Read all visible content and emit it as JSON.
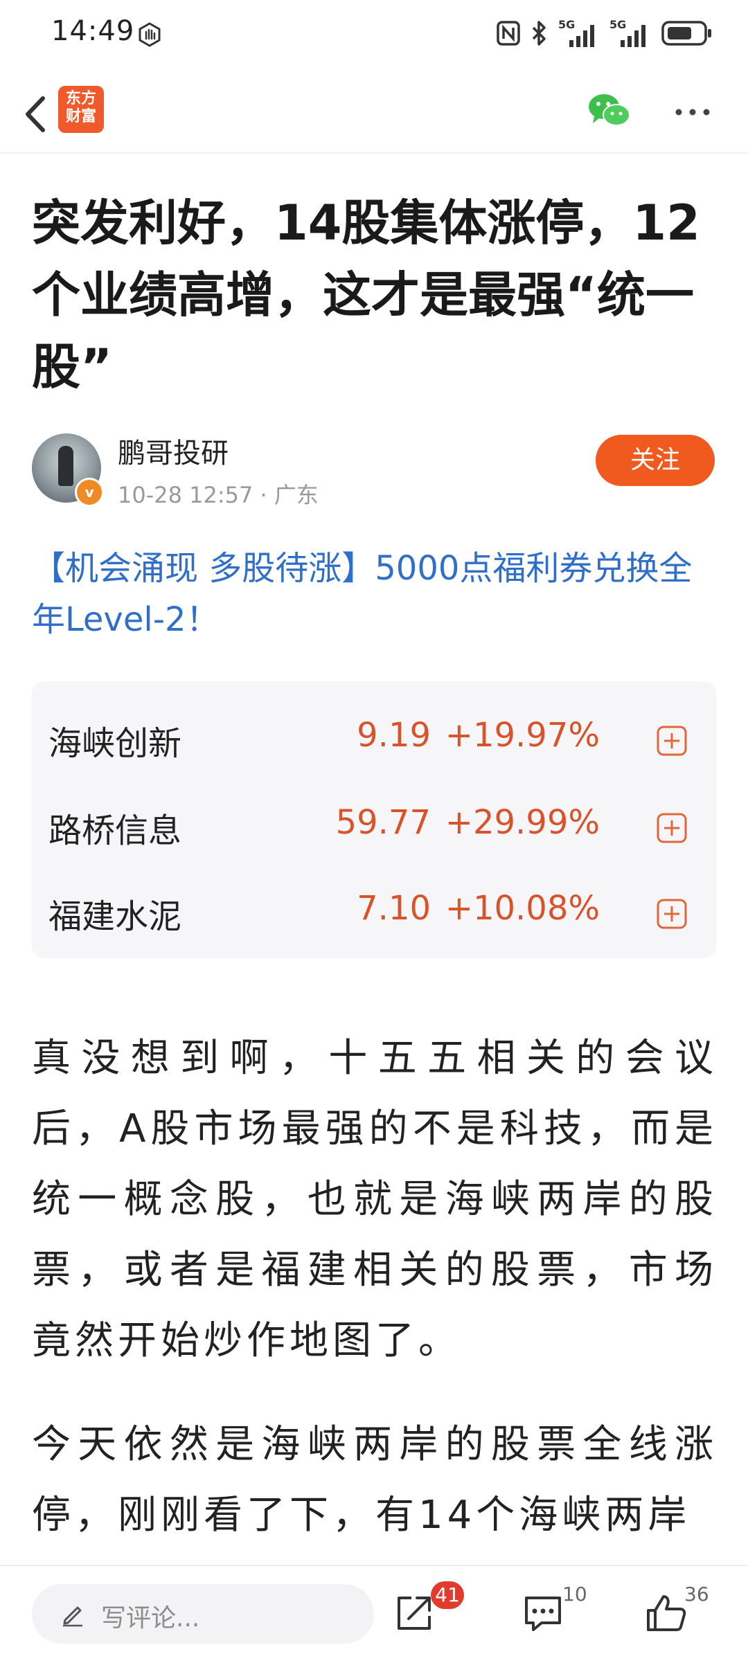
{
  "status_bar": {
    "time": "14:49",
    "network_1": "5G",
    "network_2": "5G",
    "icons": [
      "hand-icon",
      "nfc-icon",
      "bluetooth-icon",
      "signal-icon",
      "battery-icon"
    ]
  },
  "header": {
    "logo_text_line1": "东方",
    "logo_text_line2": "财富",
    "icons": [
      "back-arrow-icon",
      "wechat-icon",
      "more-icon"
    ]
  },
  "article": {
    "title": "突发利好，14股集体涨停，12个业绩高增，这才是最强“统一股”",
    "author": "鹏哥投研",
    "datetime": "10-28 12:57",
    "location": "广东",
    "verified_badge": "v",
    "follow_label": "关注",
    "promo_text": "【机会涌现 多股待涨】5000点福利券兑换全年Level-2！",
    "stocks": [
      {
        "name": "海峡创新",
        "price": "9.19",
        "change": "+19.97%"
      },
      {
        "name": "路桥信息",
        "price": "59.77",
        "change": "+29.99%"
      },
      {
        "name": "福建水泥",
        "price": "7.10",
        "change": "+10.08%"
      }
    ],
    "paragraphs": [
      "真没想到啊，十五五相关的会议后，A股市场最强的不是科技，而是统一概念股，也就是海峡两岸的股票，或者是福建相关的股票，市场竟然开始炒作地图了。",
      "今天依然是海峡两岸的股票全线涨停，刚刚看了下，有14个海峡两岸"
    ]
  },
  "bottom_bar": {
    "comment_placeholder": "写评论...",
    "share_count": "41",
    "comment_count": "10",
    "like_count": "36"
  },
  "colors": {
    "accent": "#f05a1e",
    "stock_red": "#d9532a",
    "link_blue": "#2f6fc9",
    "badge_red": "#e23b2e"
  }
}
